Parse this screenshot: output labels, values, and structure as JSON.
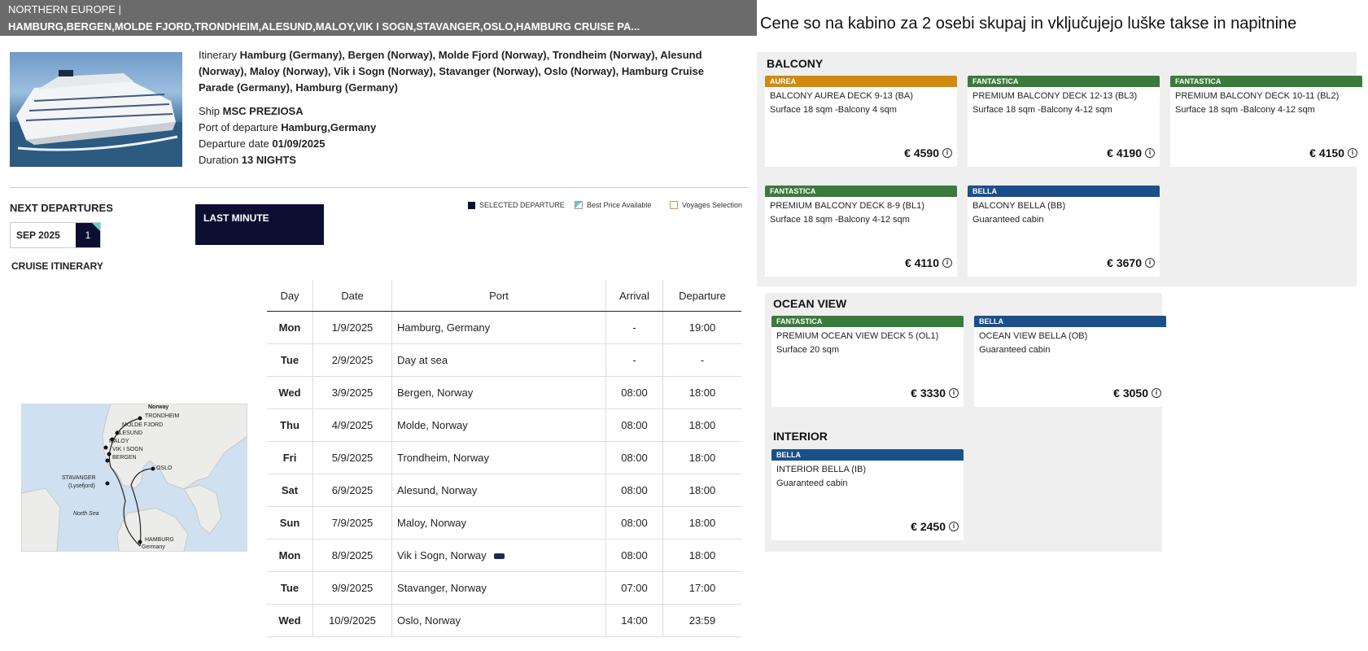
{
  "header": {
    "line1": "NORTHERN EUROPE |",
    "line2": "HAMBURG,BERGEN,MOLDE FJORD,TRONDHEIM,ALESUND,MALOY,VIK I SOGN,STAVANGER,OSLO,HAMBURG CRUISE PA..."
  },
  "info": {
    "itinerary_label": "Itinerary",
    "itinerary": "Hamburg (Germany), Bergen (Norway), Molde Fjord (Norway), Trondheim (Norway), Alesund (Norway), Maloy (Norway), Vik i Sogn (Norway), Stavanger (Norway), Oslo (Norway), Hamburg Cruise Parade (Germany), Hamburg (Germany)",
    "ship_label": "Ship",
    "ship": "MSC PREZIOSA",
    "port_label": "Port of departure",
    "port": "Hamburg,Germany",
    "date_label": "Departure date",
    "date": "01/09/2025",
    "duration_label": "Duration",
    "duration": "13 NIGHTS"
  },
  "departures": {
    "title": "NEXT DEPARTURES",
    "month": "SEP 2025",
    "count": "1",
    "last_minute": "LAST MINUTE",
    "legend": {
      "selected": "SELECTED DEPARTURE",
      "best": "Best Price Available",
      "voyages": "Voyages Selection"
    }
  },
  "itinerary_title": "CRUISE ITINERARY",
  "map_labels": {
    "norway": "Norway",
    "trondheim": "TRONDHEIM",
    "molde": "MOLDE FJORD",
    "alesund": "ALESUND",
    "maloy": "MALOY",
    "vik": "VIK I SOGN",
    "bergen": "BERGEN",
    "stavanger": "STAVANGER",
    "lysefjord": "(Lysefjord)",
    "oslo": "OSLO",
    "north_sea": "North Sea",
    "hamburg": "HAMBURG",
    "germany": "Germany"
  },
  "table": {
    "headers": {
      "day": "Day",
      "date": "Date",
      "port": "Port",
      "arrival": "Arrival",
      "departure": "Departure"
    },
    "rows": [
      {
        "day": "Mon",
        "date": "1/9/2025",
        "port": "Hamburg, Germany",
        "arrival": "-",
        "departure": "19:00"
      },
      {
        "day": "Tue",
        "date": "2/9/2025",
        "port": "Day at sea",
        "arrival": "-",
        "departure": "-"
      },
      {
        "day": "Wed",
        "date": "3/9/2025",
        "port": "Bergen, Norway",
        "arrival": "08:00",
        "departure": "18:00"
      },
      {
        "day": "Thu",
        "date": "4/9/2025",
        "port": "Molde, Norway",
        "arrival": "08:00",
        "departure": "18:00"
      },
      {
        "day": "Fri",
        "date": "5/9/2025",
        "port": "Trondheim, Norway",
        "arrival": "08:00",
        "departure": "18:00"
      },
      {
        "day": "Sat",
        "date": "6/9/2025",
        "port": "Alesund, Norway",
        "arrival": "08:00",
        "departure": "18:00"
      },
      {
        "day": "Sun",
        "date": "7/9/2025",
        "port": "Maloy, Norway",
        "arrival": "08:00",
        "departure": "18:00"
      },
      {
        "day": "Mon",
        "date": "8/9/2025",
        "port": "Vik i Sogn, Norway",
        "arrival": "08:00",
        "departure": "18:00"
      },
      {
        "day": "Tue",
        "date": "9/9/2025",
        "port": "Stavanger, Norway",
        "arrival": "07:00",
        "departure": "17:00"
      },
      {
        "day": "Wed",
        "date": "10/9/2025",
        "port": "Oslo, Norway",
        "arrival": "14:00",
        "departure": "23:59"
      }
    ]
  },
  "prices": {
    "title": "Cene so na kabino za 2 osebi skupaj in vključujejo luške takse in napitnine",
    "balcony_title": "BALCONY",
    "ocean_title": "OCEAN VIEW",
    "interior_title": "INTERIOR",
    "balcony": [
      {
        "tag": "AUREA",
        "color": "#d08a0e",
        "name": "BALCONY AUREA DECK 9-13 (BA)",
        "sub": "Surface 18 sqm -Balcony 4 sqm",
        "price": "€ 4590"
      },
      {
        "tag": "FANTASTICA",
        "color": "#3a7a3c",
        "name": "PREMIUM BALCONY DECK 12-13 (BL3)",
        "sub": "Surface 18 sqm -Balcony 4-12 sqm",
        "price": "€ 4190"
      },
      {
        "tag": "FANTASTICA",
        "color": "#3a7a3c",
        "name": "PREMIUM BALCONY DECK 10-11 (BL2)",
        "sub": "Surface 18 sqm -Balcony 4-12 sqm",
        "price": "€ 4150"
      },
      {
        "tag": "FANTASTICA",
        "color": "#3a7a3c",
        "name": "PREMIUM BALCONY DECK 8-9 (BL1)",
        "sub": "Surface 18 sqm -Balcony 4-12 sqm",
        "price": "€ 4110"
      },
      {
        "tag": "BELLA",
        "color": "#1b4f8a",
        "name": "BALCONY BELLA (BB)",
        "sub": "Guaranteed cabin",
        "price": "€ 3670"
      }
    ],
    "ocean": [
      {
        "tag": "FANTASTICA",
        "color": "#3a7a3c",
        "name": "PREMIUM OCEAN VIEW DECK 5 (OL1)",
        "sub": "Surface 20 sqm",
        "price": "€ 3330"
      },
      {
        "tag": "BELLA",
        "color": "#1b4f8a",
        "name": "OCEAN VIEW BELLA (OB)",
        "sub": "Guaranteed cabin",
        "price": "€ 3050"
      }
    ],
    "interior": [
      {
        "tag": "BELLA",
        "color": "#1b4f8a",
        "name": "INTERIOR BELLA (IB)",
        "sub": "Guaranteed cabin",
        "price": "€ 2450"
      }
    ]
  }
}
